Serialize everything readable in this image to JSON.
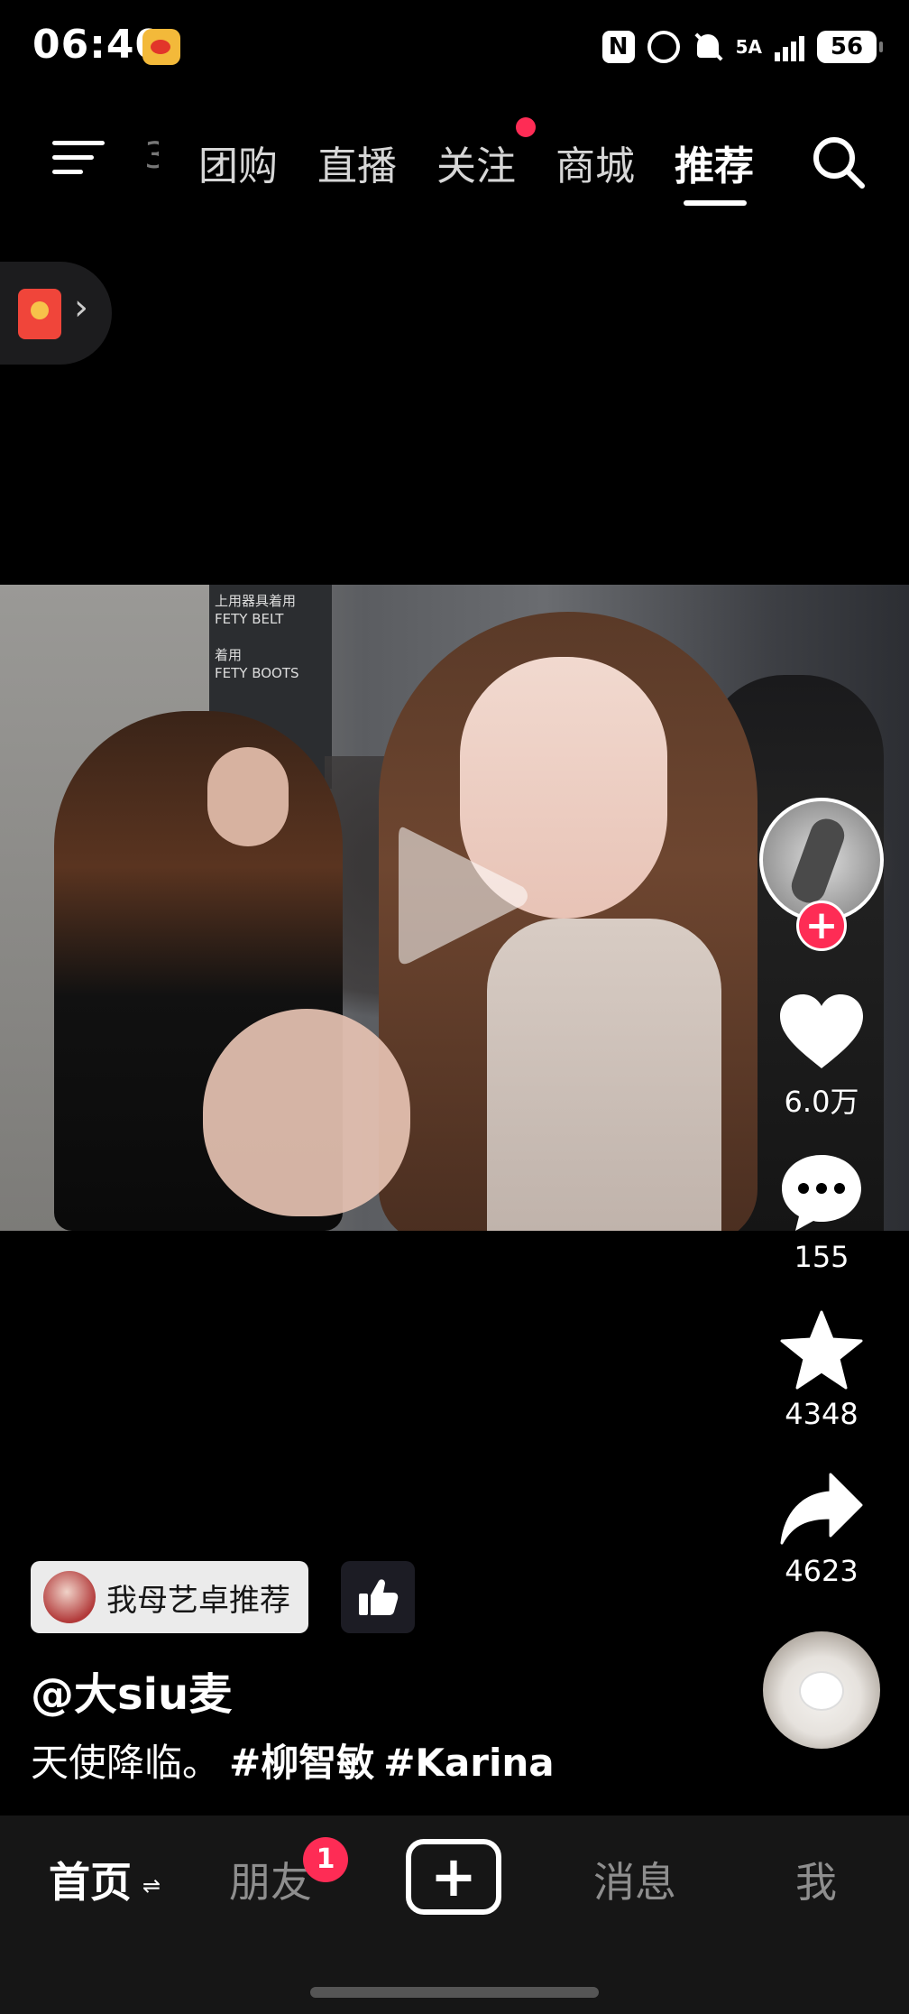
{
  "status_bar": {
    "time": "06:40",
    "network": "5A",
    "battery": "56"
  },
  "top_nav": {
    "tabs": [
      {
        "label": "团购"
      },
      {
        "label": "直播"
      },
      {
        "label": "关注"
      },
      {
        "label": "商城"
      },
      {
        "label": "推荐"
      }
    ],
    "active_tab": "推荐"
  },
  "video": {
    "sign_text": "上用器具着用\nFETY BELT\n着用\nFETY BOOTS"
  },
  "actions": {
    "likes": "6.0万",
    "comments": "155",
    "favorites": "4348",
    "shares": "4623"
  },
  "info": {
    "related_label": "我母艺卓推荐",
    "author": "@大siu麦",
    "caption_text": "天使降临。",
    "hashtags": [
      "#柳智敏",
      "#Karina"
    ]
  },
  "bottom_nav": {
    "home": "首页",
    "swap_glyph": "⇌",
    "friends": "朋友",
    "friends_badge": "1",
    "add": "+",
    "messages": "消息",
    "me": "我"
  },
  "colors": {
    "accent_red": "#fe2c55",
    "background": "#000000",
    "bottom_bar": "#161616"
  },
  "icons": [
    "menu-icon",
    "search-icon",
    "red-packet-icon",
    "play-icon",
    "heart-icon",
    "comment-icon",
    "star-icon",
    "share-icon",
    "thumbs-up-icon",
    "add-icon"
  ]
}
